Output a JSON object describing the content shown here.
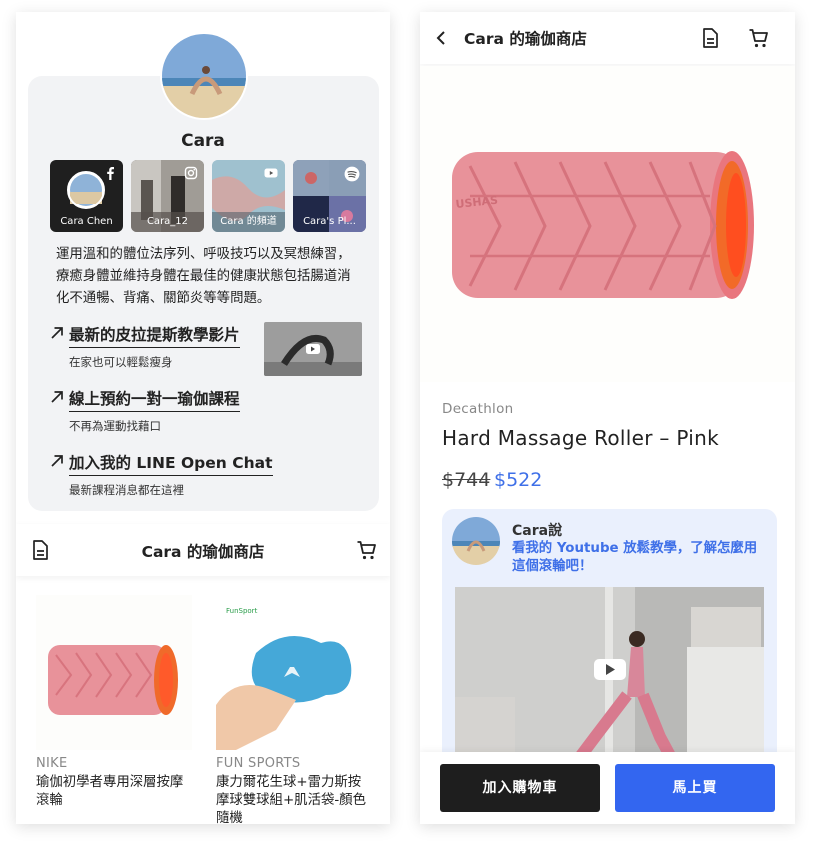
{
  "profile": {
    "name": "Cara",
    "social": [
      {
        "label": "Cara Chen",
        "icon": "facebook-icon"
      },
      {
        "label": "Cara_12",
        "icon": "instagram-icon"
      },
      {
        "label": "Cara 的頻道",
        "icon": "youtube-icon"
      },
      {
        "label": "Cara's Pl...",
        "icon": "spotify-icon"
      }
    ],
    "bio": "運用溫和的體位法序列、呼吸技巧以及冥想練習，療癒身體並維持身體在最佳的健康狀態包括腸道消化不通暢、背痛、關節炎等等問題。",
    "links": [
      {
        "title": "最新的皮拉提斯教學影片",
        "subtitle": "在家也可以輕鬆瘦身"
      },
      {
        "title": "線上預約一對一瑜伽課程",
        "subtitle": "不再為運動找藉口"
      },
      {
        "title": "加入我的 LINE Open Chat",
        "subtitle": "最新課程消息都在這裡"
      }
    ]
  },
  "shop": {
    "title": "Cara 的瑜伽商店",
    "products": [
      {
        "brand": "NIKE",
        "name": "瑜伽初學者專用深層按摩滾輪"
      },
      {
        "brand": "FUN SPORTS",
        "name": "康力爾花生球+雷力斯按摩球雙球組+肌活袋-顏色隨機"
      }
    ]
  },
  "detail": {
    "store_title": "Cara 的瑜伽商店",
    "brand": "Decathlon",
    "name": "Hard Massage Roller – Pink",
    "old_price": "$744",
    "new_price": "$522",
    "note_author": "Cara說",
    "note_text": "看我的 Youtube 放鬆教學，了解怎麼用這個滾輪吧！",
    "add_to_cart": "加入購物車",
    "buy_now": "馬上買"
  },
  "colors": {
    "accent": "#3366f0",
    "price": "#3f70e8",
    "card_bg": "#f2f3f5",
    "note_bg": "#eaf0fd",
    "dark_button": "#1e1e1e"
  }
}
